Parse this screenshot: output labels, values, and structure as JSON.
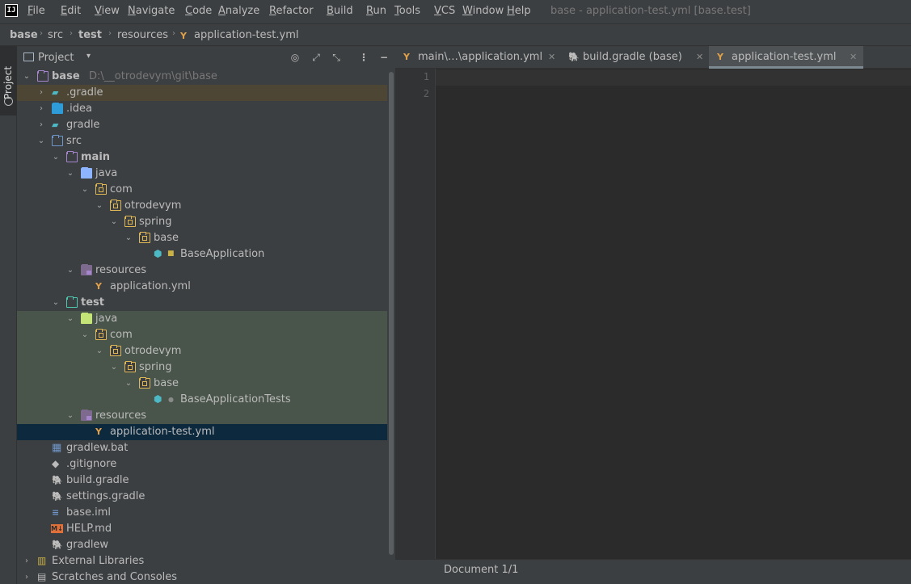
{
  "menubar": {
    "items": [
      "File",
      "Edit",
      "View",
      "Navigate",
      "Code",
      "Analyze",
      "Refactor",
      "Build",
      "Run",
      "Tools",
      "VCS",
      "Window",
      "Help"
    ],
    "window_title": "base - application-test.yml [base.test]",
    "logo_text": "IJ"
  },
  "breadcrumb": [
    "base",
    "src",
    "test",
    "resources",
    "application-test.yml"
  ],
  "tool_stripe": {
    "project_label": "Project"
  },
  "project_panel": {
    "title": "Project",
    "tree": [
      {
        "label": "base",
        "path": "D:\\__otrodevym\\git\\base"
      },
      {
        "label": ".gradle"
      },
      {
        "label": ".idea"
      },
      {
        "label": "gradle"
      },
      {
        "label": "src"
      },
      {
        "label": "main"
      },
      {
        "label": "java"
      },
      {
        "label": "com"
      },
      {
        "label": "otrodevym"
      },
      {
        "label": "spring"
      },
      {
        "label": "base"
      },
      {
        "label": "BaseApplication"
      },
      {
        "label": "resources"
      },
      {
        "label": "application.yml"
      },
      {
        "label": "test"
      },
      {
        "label": "java"
      },
      {
        "label": "com"
      },
      {
        "label": "otrodevym"
      },
      {
        "label": "spring"
      },
      {
        "label": "base"
      },
      {
        "label": "BaseApplicationTests"
      },
      {
        "label": "resources"
      },
      {
        "label": "application-test.yml"
      },
      {
        "label": "gradlew.bat"
      },
      {
        "label": ".gitignore"
      },
      {
        "label": "build.gradle"
      },
      {
        "label": "settings.gradle"
      },
      {
        "label": "base.iml"
      },
      {
        "label": "HELP.md"
      },
      {
        "label": "gradlew"
      },
      {
        "label": "External Libraries"
      },
      {
        "label": "Scratches and Consoles"
      }
    ]
  },
  "editor": {
    "tabs": [
      {
        "label": "main\\…\\application.yml"
      },
      {
        "label": "build.gradle (base)"
      },
      {
        "label": "application-test.yml"
      }
    ],
    "line_numbers": [
      "1",
      "2"
    ]
  },
  "status_bar": {
    "text": "Document 1/1"
  },
  "colors": {
    "selection": "#0d293e",
    "test_highlight": "#49544a",
    "gradle_highlight": "#4d4635"
  }
}
